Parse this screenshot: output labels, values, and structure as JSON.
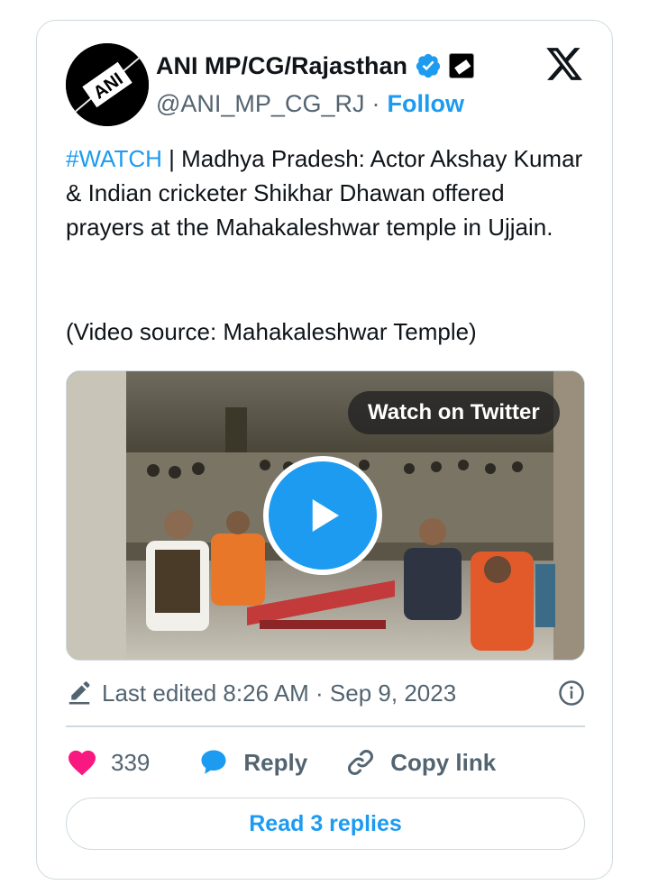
{
  "account": {
    "name": "ANI MP/CG/Rajasthan",
    "handle": "@ANI_MP_CG_RJ",
    "separator": "·",
    "follow_label": "Follow",
    "avatar_text": "ANI"
  },
  "tweet": {
    "hashtag": "#WATCH",
    "text": " | Madhya Pradesh: Actor Akshay Kumar & Indian cricketer Shikhar Dhawan offered prayers at the Mahakaleshwar temple in Ujjain.",
    "source": "(Video source: Mahakaleshwar Temple)"
  },
  "media": {
    "watch_label": "Watch on Twitter"
  },
  "meta": {
    "edited_text": "Last edited 8:26 AM · Sep 9, 2023"
  },
  "actions": {
    "likes": "339",
    "reply_label": "Reply",
    "copy_label": "Copy link"
  },
  "read_replies_label": "Read 3 replies",
  "colors": {
    "accent": "#1d9bf0",
    "like": "#f91880",
    "secondary_text": "#536471",
    "border": "#cfd9de"
  },
  "icons": [
    "verified-icon",
    "affiliate-badge-icon",
    "x-logo-icon",
    "play-icon",
    "pencil-icon",
    "info-icon",
    "heart-icon",
    "reply-bubble-icon",
    "link-icon"
  ]
}
